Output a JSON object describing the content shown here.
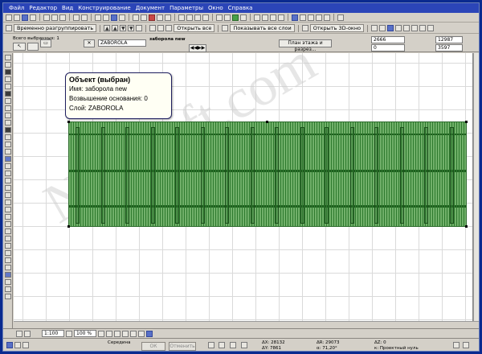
{
  "menu": [
    "Файл",
    "Редактор",
    "Вид",
    "Конструирование",
    "Документ",
    "Параметры",
    "Окно",
    "Справка"
  ],
  "toolbar2": {
    "regroup_label": "Временно разгруппировать",
    "open_all_label": "Открыть все",
    "show_layers_label": "Показывать все слои",
    "open_3d_label": "Открыть 3D-окно"
  },
  "info_box": {
    "selection_label": "Всего выбранных: 1",
    "layer_value": "ZABOROLA",
    "object_name": "заборола new",
    "story_button": "План этажа и разрез...",
    "elev1": "2666",
    "elev2": "0",
    "dim_a": "12987",
    "dim_b": "3597"
  },
  "tooltip": {
    "title": "Объект (выбран)",
    "name_line": "Имя: заборола new",
    "base_line": "Возвышение основания: 0",
    "layer_line": "Слой: ZABOROLA"
  },
  "watermark": "Nicesoft.com",
  "status": {
    "scale": "1:100",
    "zoom": "100 %"
  },
  "coords": {
    "snap_label": "Середина",
    "ok": "ОК",
    "cancel": "Отменить",
    "dx": "ΔX: 28132",
    "dy": "ΔY: 7861",
    "dr": "ΔR: 29073",
    "da": "α: 71,20°",
    "dz": "ΔZ: 0",
    "origin": "к: Проектный нуль"
  }
}
